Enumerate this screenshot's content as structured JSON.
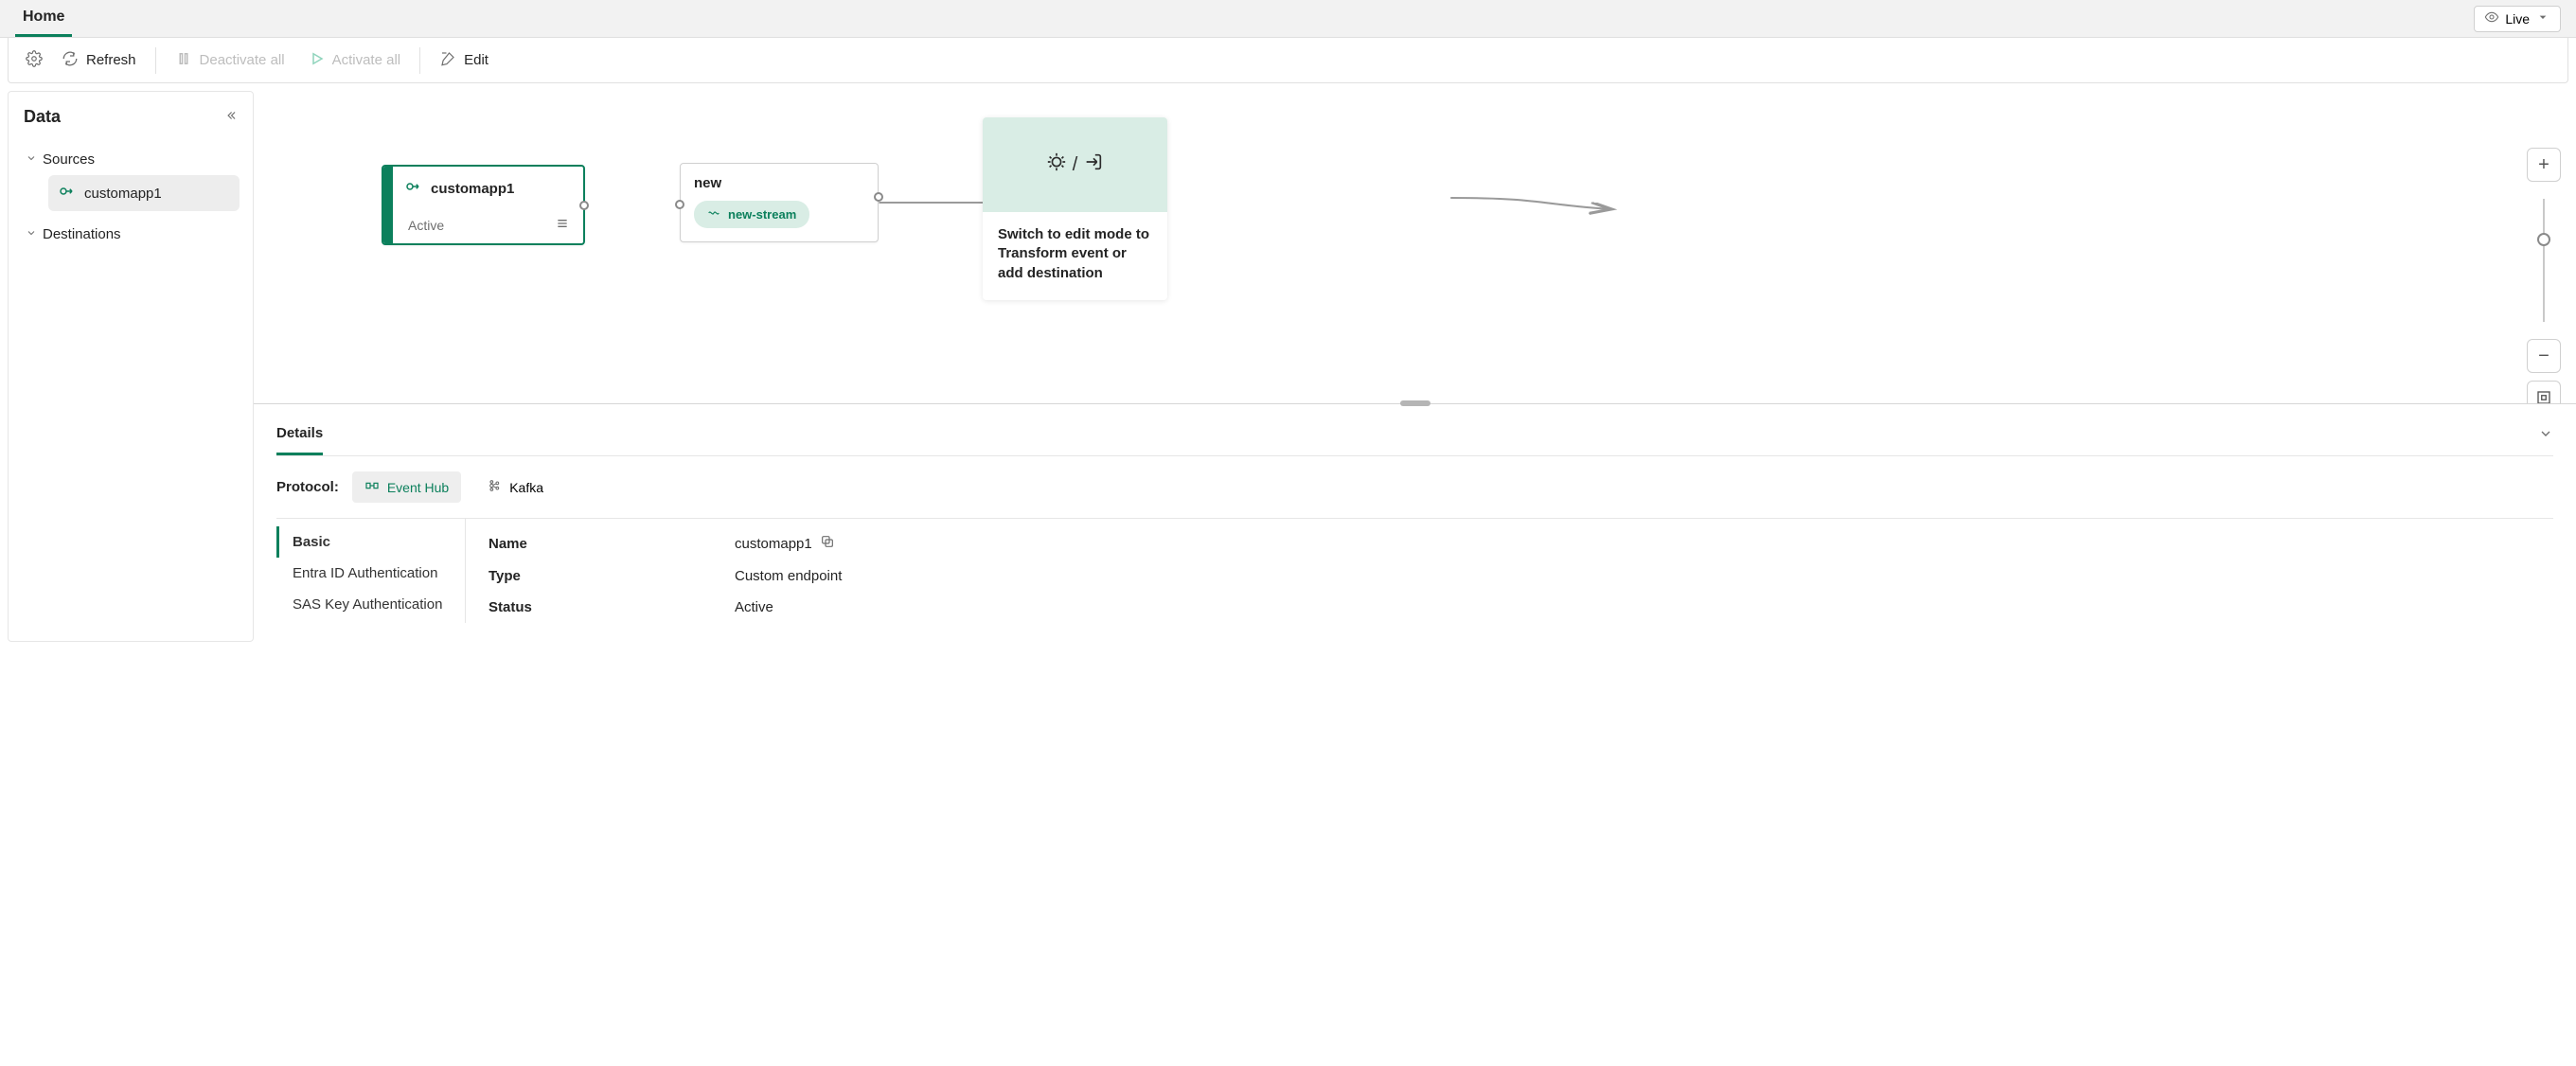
{
  "header": {
    "home_tab": "Home",
    "live_label": "Live"
  },
  "toolbar": {
    "refresh": "Refresh",
    "deactivate_all": "Deactivate all",
    "activate_all": "Activate all",
    "edit": "Edit"
  },
  "sidebar": {
    "title": "Data",
    "sources_label": "Sources",
    "destinations_label": "Destinations",
    "sources": [
      {
        "name": "customapp1"
      }
    ]
  },
  "canvas": {
    "source": {
      "name": "customapp1",
      "status": "Active"
    },
    "stream": {
      "title": "new",
      "pill": "new-stream"
    },
    "placeholder": {
      "sep": "/",
      "text": "Switch to edit mode to Transform event or add destination"
    }
  },
  "details": {
    "tab": "Details",
    "protocol_label": "Protocol:",
    "protocols": {
      "eventhub": "Event Hub",
      "kafka": "Kafka"
    },
    "side_tabs": {
      "basic": "Basic",
      "entra": "Entra ID Authentication",
      "sas": "SAS Key Authentication"
    },
    "fields": {
      "name_label": "Name",
      "name_value": "customapp1",
      "type_label": "Type",
      "type_value": "Custom endpoint",
      "status_label": "Status",
      "status_value": "Active"
    }
  }
}
